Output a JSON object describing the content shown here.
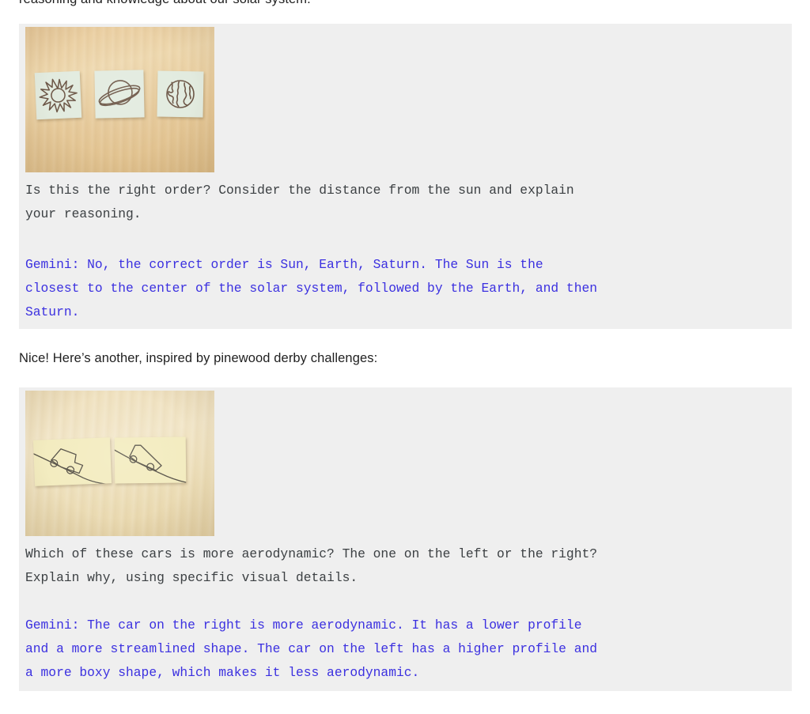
{
  "page": {
    "background_color": "#ffffff",
    "block_background_color": "#efefef",
    "prompt_text_color": "#3c4043",
    "gemini_text_color": "#3b30e0"
  },
  "top_clipped_paragraph": {
    "text": "reasoning and knowledge about our solar system."
  },
  "interstitial_paragraph": {
    "text": "Nice! Here’s another, inspired by pinewood derby challenges:"
  },
  "examples": [
    {
      "id": "solar-system-example",
      "photo": {
        "alt": "Three sticky notes on a light wooden table, each with a hand drawing: a sun, a ringed planet (Saturn), and the Earth",
        "surface": "light wood tabletop",
        "note_color": "#e2ebdf",
        "notes": [
          {
            "name": "sun-sticky-note",
            "drawing": "sun-icon"
          },
          {
            "name": "saturn-sticky-note",
            "drawing": "saturn-icon"
          },
          {
            "name": "earth-sticky-note",
            "drawing": "earth-icon"
          }
        ]
      },
      "prompt": "Is this the right order? Consider the distance from the sun and explain\nyour reasoning.",
      "response": "Gemini: No, the correct order is Sun, Earth, Saturn. The Sun is the\nclosest to the center of the solar system, followed by the Earth, and then\nSaturn."
    },
    {
      "id": "pinewood-derby-example",
      "photo": {
        "alt": "Two yellow sticky notes on a light wooden table, each with a hand drawing of a car rolling down a slope",
        "surface": "light wood tabletop",
        "note_color": "#f3ecc0",
        "notes": [
          {
            "name": "boxy-car-sticky-note",
            "drawing": "boxy-car-on-slope-icon"
          },
          {
            "name": "wedge-car-sticky-note",
            "drawing": "wedge-car-on-slope-icon"
          }
        ]
      },
      "prompt": "Which of these cars is more aerodynamic? The one on the left or the right?\nExplain why, using specific visual details.",
      "response": "Gemini: The car on the right is more aerodynamic. It has a lower profile\nand a more streamlined shape. The car on the left has a higher profile and\na more boxy shape, which makes it less aerodynamic."
    }
  ]
}
